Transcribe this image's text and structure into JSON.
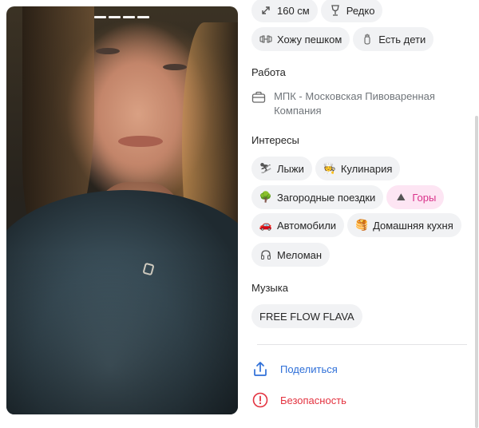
{
  "profile_details": {
    "height": "160 см",
    "drinking": "Редко",
    "sport": "Хожу пешком",
    "children": "Есть дети"
  },
  "work": {
    "title": "Работа",
    "company": "МПК - Московская Пивоваренная Компания"
  },
  "interests": {
    "title": "Интересы",
    "items": [
      {
        "label": "Лыжи",
        "icon": "skier-emoji",
        "highlighted": false
      },
      {
        "label": "Кулинария",
        "icon": "cook-emoji",
        "highlighted": false
      },
      {
        "label": "Загородные поездки",
        "icon": "tree-emoji",
        "highlighted": false
      },
      {
        "label": "Горы",
        "icon": "mountain-emoji",
        "highlighted": true
      },
      {
        "label": "Автомобили",
        "icon": "car-emoji",
        "highlighted": false
      },
      {
        "label": "Домашняя кухня",
        "icon": "pancake-emoji",
        "highlighted": false
      },
      {
        "label": "Меломан",
        "icon": "headphones-icon",
        "highlighted": false
      }
    ]
  },
  "music": {
    "title": "Музыка",
    "artist": "FREE FLOW FLAVA"
  },
  "actions": {
    "share": "Поделиться",
    "safety": "Безопасность"
  },
  "colors": {
    "chip_bg": "#f1f2f4",
    "highlight_bg": "#fde5f3",
    "highlight_text": "#d9318a",
    "link": "#2e6fd8",
    "danger": "#e3323f"
  },
  "photo": {
    "pages_total": 4
  }
}
